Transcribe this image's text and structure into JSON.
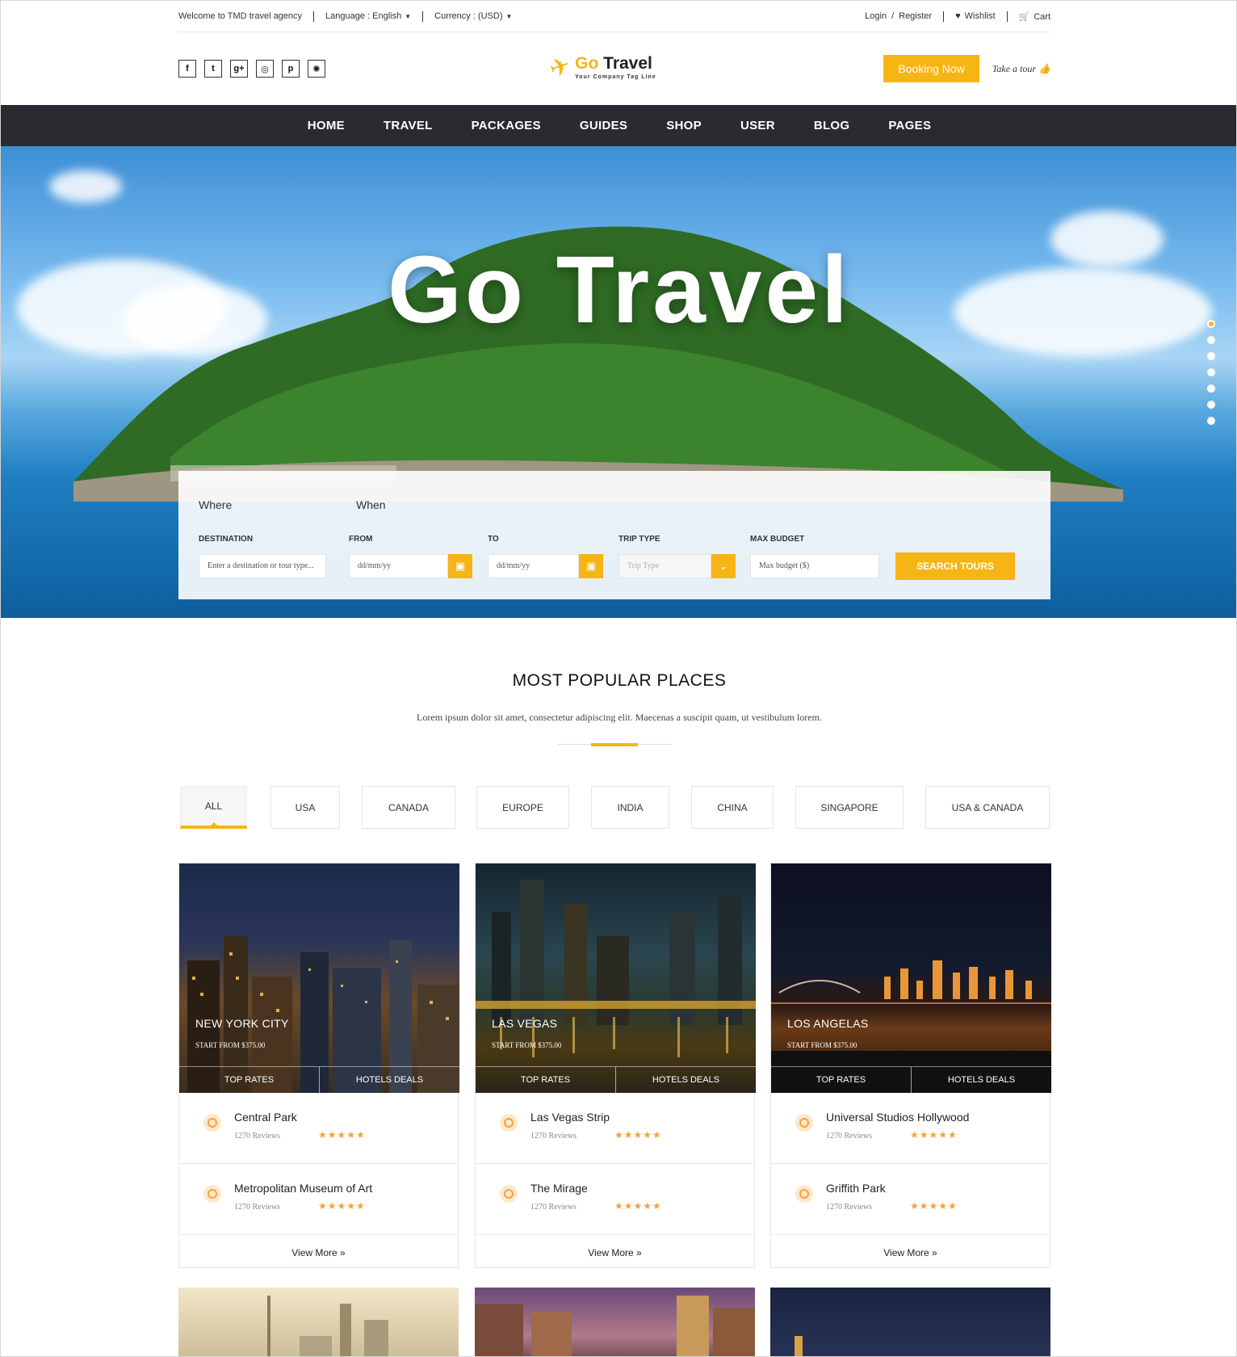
{
  "topbar": {
    "welcome": "Welcome to TMD travel agency",
    "language": "Language : English",
    "currency": "Currency : (USD)",
    "login": "Login",
    "register": "Register",
    "wishlist": "Wishlist",
    "cart": "Cart"
  },
  "header": {
    "logo_go": "Go",
    "logo_travel": "Travel",
    "logo_tagline": "Your Company Tag Line",
    "booking_button": "Booking Now",
    "take_tour": "Take a tour"
  },
  "nav": [
    "HOME",
    "TRAVEL",
    "PACKAGES",
    "GUIDES",
    "SHOP",
    "USER",
    "BLOG",
    "PAGES"
  ],
  "hero": {
    "title": "Go Travel"
  },
  "search": {
    "where": "Where",
    "when": "When",
    "destination_label": "DESTINATION",
    "destination_placeholder": "Enter a destination or tour type...",
    "from_label": "FROM",
    "from_placeholder": "dd/mm/yy",
    "to_label": "TO",
    "to_placeholder": "dd/mm/yy",
    "trip_type_label": "TRIP TYPE",
    "trip_type_placeholder": "Trip Type",
    "budget_label": "MAX BUDGET",
    "budget_placeholder": "Max budget ($)",
    "button": "SEARCH TOURS"
  },
  "popular": {
    "title": "MOST POPULAR PLACES",
    "description": "Lorem ipsum dolor sit amet, consectetur adipiscing elit. Maecenas a suscipit quam, ut vestibulum lorem."
  },
  "filters": [
    "ALL",
    "USA",
    "CANADA",
    "EUROPE",
    "INDIA",
    "CHINA",
    "SINGAPORE",
    "USA & CANADA"
  ],
  "cards": [
    {
      "city": "NEW YORK CITY",
      "start": "START FROM $375.00",
      "tab1": "TOP RATES",
      "tab2": "HOTELS DEALS",
      "items": [
        {
          "name": "Central Park",
          "reviews": "1270 Reviews",
          "stars": "★★★★★"
        },
        {
          "name": "Metropolitan Museum of Art",
          "reviews": "1270 Reviews",
          "stars": "★★★★★"
        }
      ],
      "view_more": "View More »"
    },
    {
      "city": "LAS VEGAS",
      "start": "START FROM $375.00",
      "tab1": "TOP RATES",
      "tab2": "HOTELS DEALS",
      "items": [
        {
          "name": "Las Vegas Strip",
          "reviews": "1270 Reviews",
          "stars": "★★★★★"
        },
        {
          "name": "The Mirage",
          "reviews": "1270 Reviews",
          "stars": "★★★★★"
        }
      ],
      "view_more": "View More »"
    },
    {
      "city": "LOS ANGELAS",
      "start": "START FROM $375.00",
      "tab1": "TOP RATES",
      "tab2": "HOTELS DEALS",
      "items": [
        {
          "name": "Universal Studios Hollywood",
          "reviews": "1270 Reviews",
          "stars": "★★★★★"
        },
        {
          "name": "Griffith Park",
          "reviews": "1270 Reviews",
          "stars": "★★★★★"
        }
      ],
      "view_more": "View More »"
    }
  ],
  "colors": {
    "accent": "#f7b415",
    "nav_bg": "#2a2b30",
    "star": "#f5a23b"
  }
}
